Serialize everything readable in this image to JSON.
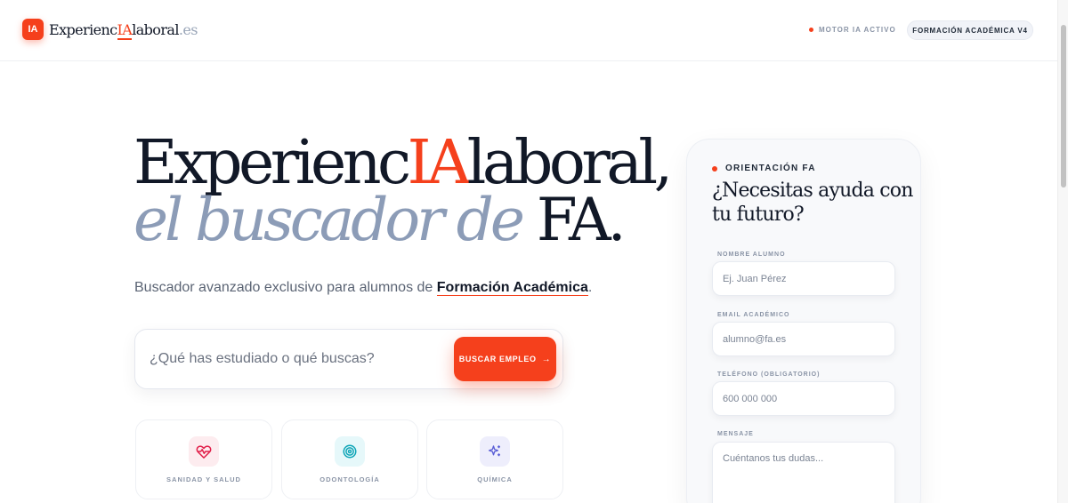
{
  "header": {
    "logo_badge": "IA",
    "logo_pre": "Experienc",
    "logo_ia": "IA",
    "logo_post": "laboral",
    "logo_tld": ".es",
    "status_label": "MOTOR IA ACTIVO",
    "version_pill": "FORMACIÓN ACADÉMICA V4"
  },
  "hero": {
    "title_pre": "Experienc",
    "title_ia": "IA",
    "title_post": "laboral,",
    "subtitle_italic": "el buscador de",
    "subtitle_strong": "FA.",
    "tagline_pre": "Buscador avanzado exclusivo para alumnos de",
    "tagline_brand": "Formación Académica",
    "tagline_post": "."
  },
  "search": {
    "placeholder": "¿Qué has estudiado o qué buscas?",
    "button_label": "BUSCAR EMPLEO",
    "button_arrow": "→"
  },
  "categories": [
    {
      "label": "SANIDAD Y SALUD",
      "icon": "heart-pulse-icon",
      "color": "#e11d48",
      "bg": "#fdecef"
    },
    {
      "label": "ODONTOLOGÍA",
      "icon": "target-icon",
      "color": "#0ea5b7",
      "bg": "#e6f8fa"
    },
    {
      "label": "QUÍMICA",
      "icon": "sparkles-icon",
      "color": "#5b5fd6",
      "bg": "#eeeefc"
    }
  ],
  "form": {
    "eyebrow": "ORIENTACIÓN FA",
    "title": "¿Necesitas ayuda con tu futuro?",
    "name_label": "NOMBRE ALUMNO",
    "name_placeholder": "Ej. Juan Pérez",
    "email_label": "EMAIL ACADÉMICO",
    "email_placeholder": "alumno@fa.es",
    "phone_label": "TELÉFONO (OBLIGATORIO)",
    "phone_placeholder": "600 000 000",
    "message_label": "MENSAJE",
    "message_placeholder": "Cuéntanos tus dudas..."
  },
  "colors": {
    "accent": "#f5401c",
    "muted_heading": "#8c9cb7",
    "text": "#111827"
  }
}
